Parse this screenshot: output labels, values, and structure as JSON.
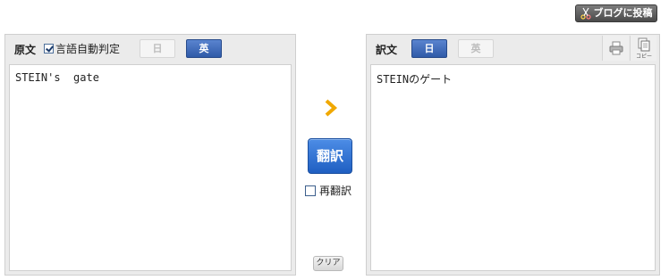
{
  "toolbar": {
    "blog_post_label": "ブログに投稿"
  },
  "source_panel": {
    "label": "原文",
    "auto_detect_label": "言語自動判定",
    "auto_detect_checked": true,
    "lang_ja_label": "日",
    "lang_en_label": "英",
    "selected_lang": "英",
    "text": "STEIN's  gate"
  },
  "controls": {
    "translate_label": "翻訳",
    "retranslate_label": "再翻訳",
    "retranslate_checked": false,
    "clear_label": "クリア"
  },
  "target_panel": {
    "label": "訳文",
    "lang_ja_label": "日",
    "lang_en_label": "英",
    "selected_lang": "日",
    "copy_label": "コピー",
    "text": "STEINのゲート"
  },
  "colors": {
    "accent_blue": "#2f5aa8",
    "translate_blue": "#1f5fc2",
    "arrow_orange": "#f0a800",
    "panel_bg": "#ebebeb"
  }
}
